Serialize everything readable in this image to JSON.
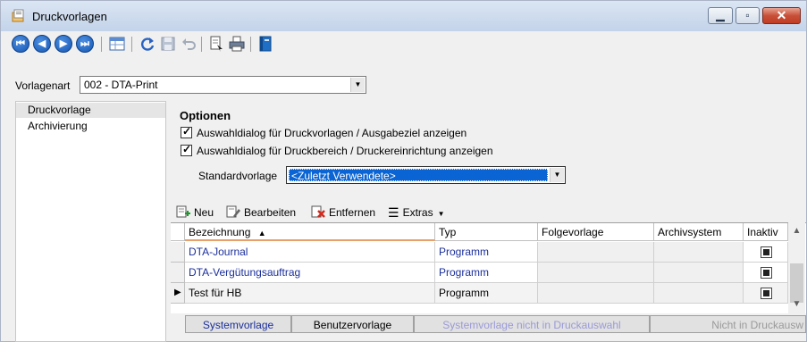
{
  "window": {
    "title": "Druckvorlagen"
  },
  "toolbar": {
    "icons": [
      "first-record-icon",
      "previous-record-icon",
      "next-record-icon",
      "last-record-icon",
      "table-view-icon",
      "refresh-icon",
      "save-icon",
      "undo-icon",
      "print-preview-icon",
      "print-icon",
      "book-icon"
    ],
    "nav_glyphs": [
      "⏮",
      "◀",
      "▶",
      "⏭"
    ]
  },
  "vorlagenart": {
    "label": "Vorlagenart",
    "value": "002 - DTA-Print"
  },
  "left_list": {
    "items": [
      "Druckvorlage",
      "Archivierung"
    ],
    "selected": 0
  },
  "options": {
    "title": "Optionen",
    "checkbox1": "Auswahldialog für Druckvorlagen / Ausgabeziel anzeigen",
    "checkbox2": "Auswahldialog für Druckbereich / Druckereinrichtung anzeigen",
    "checkbox1_checked": true,
    "checkbox2_checked": true,
    "standard_label": "Standardvorlage",
    "standard_value": "<Zuletzt Verwendete>"
  },
  "grid_toolbar": {
    "new": "Neu",
    "edit": "Bearbeiten",
    "remove": "Entfernen",
    "extras": "Extras"
  },
  "grid": {
    "columns": [
      "Bezeichnung",
      "Typ",
      "Folgevorlage",
      "Archivsystem",
      "Inaktiv"
    ],
    "sort_column": "Bezeichnung",
    "rows": [
      {
        "bezeichnung": "DTA-Journal",
        "typ": "Programm",
        "folgevorlage": "",
        "archivsystem": "",
        "inaktiv": true,
        "style": "system"
      },
      {
        "bezeichnung": "DTA-Vergütungsauftrag",
        "typ": "Programm",
        "folgevorlage": "",
        "archivsystem": "",
        "inaktiv": true,
        "style": "system"
      },
      {
        "bezeichnung": "Test für HB",
        "typ": "Programm",
        "folgevorlage": "",
        "archivsystem": "",
        "inaktiv": true,
        "style": "user",
        "current": true
      }
    ]
  },
  "legend": {
    "system": "Systemvorlage",
    "user": "Benutzervorlage",
    "not_selected": "Systemvorlage nicht in Druckauswahl",
    "not_in": "Nicht in Druckausw"
  },
  "colors": {
    "accent_blue": "#0a64d3",
    "system_text": "#1b2f9b",
    "disabled_text": "#9a9ad8"
  }
}
